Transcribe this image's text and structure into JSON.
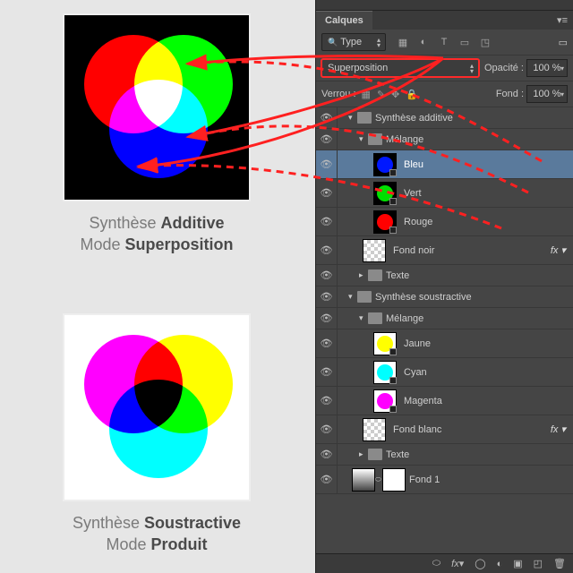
{
  "panel": {
    "title": "Calques",
    "kind_label": "Type",
    "blend_mode": "Superposition",
    "opacity_label": "Opacité :",
    "opacity_value": "100 %",
    "lock_label": "Verrou :",
    "fill_label": "Fond :",
    "fill_value": "100 %"
  },
  "layers": [
    {
      "type": "group",
      "depth": 1,
      "open": true,
      "name": "Synthèse additive"
    },
    {
      "type": "group",
      "depth": 2,
      "open": true,
      "name": "Mélange"
    },
    {
      "type": "layer",
      "depth": 3,
      "color": "blue",
      "bg": "black",
      "name": "Bleu",
      "selected": true
    },
    {
      "type": "layer",
      "depth": 3,
      "color": "green",
      "bg": "black",
      "name": "Vert"
    },
    {
      "type": "layer",
      "depth": 3,
      "color": "red",
      "bg": "black",
      "name": "Rouge"
    },
    {
      "type": "layer",
      "depth": 2,
      "checker": true,
      "name": "Fond noir",
      "fx": "fx"
    },
    {
      "type": "group",
      "depth": 2,
      "open": false,
      "name": "Texte"
    },
    {
      "type": "group",
      "depth": 1,
      "open": true,
      "name": "Synthèse soustractive"
    },
    {
      "type": "group",
      "depth": 2,
      "open": true,
      "name": "Mélange"
    },
    {
      "type": "layer",
      "depth": 3,
      "color": "yellow",
      "bg": "white",
      "name": "Jaune"
    },
    {
      "type": "layer",
      "depth": 3,
      "color": "cyan",
      "bg": "white",
      "name": "Cyan"
    },
    {
      "type": "layer",
      "depth": 3,
      "color": "magenta",
      "bg": "white",
      "name": "Magenta"
    },
    {
      "type": "layer",
      "depth": 2,
      "checker": true,
      "name": "Fond blanc",
      "fx": "fx"
    },
    {
      "type": "group",
      "depth": 2,
      "open": false,
      "name": "Texte"
    },
    {
      "type": "grad",
      "depth": 1,
      "name": "Fond 1"
    }
  ],
  "captions": {
    "add_l1a": "Synthèse ",
    "add_l1b": "Additive",
    "add_l2a": "Mode ",
    "add_l2b": "Superposition",
    "sub_l1a": "Synthèse ",
    "sub_l1b": "Soustractive",
    "sub_l2a": "Mode ",
    "sub_l2b": "Produit"
  },
  "annotation": {
    "highlight_target": "blend-mode-select"
  }
}
